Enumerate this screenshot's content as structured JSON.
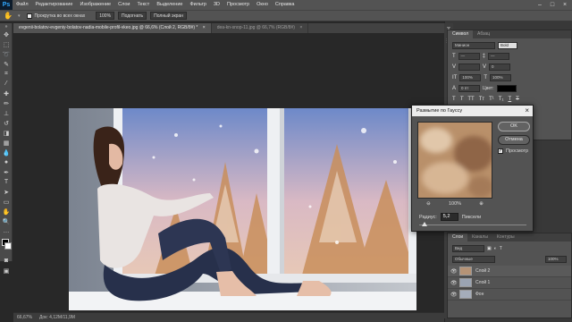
{
  "menu": {
    "app": "Ps",
    "items": [
      "Файл",
      "Редактирование",
      "Изображение",
      "Слои",
      "Текст",
      "Выделение",
      "Фильтр",
      "3D",
      "Просмотр",
      "Окно",
      "Справка"
    ]
  },
  "options": {
    "scroll_all": "Прокрутка во всех окнах",
    "zoom": "100%",
    "fit_button": "Подогнать",
    "full_screen_button": "Полный экран"
  },
  "tabs": [
    {
      "label": "evgenii-bolatov-evgeniy-bolatov-nadia-mobile-profil-vkeo.jpg @ 66,6% (Слой 2, RGB/8#) *",
      "close": "×"
    },
    {
      "label": "dea-kn-snop-11.jpg @ 66,7% (RGB/8#)",
      "close": "×"
    }
  ],
  "status": {
    "zoom": "66,67%",
    "doc": "Док: 4,12M/11,9M"
  },
  "character_panel": {
    "tabs": [
      "Символ",
      "Абзац"
    ],
    "font_family": "Минион",
    "font_style": "Bold",
    "size": "—",
    "leading": "—",
    "tracking": "0",
    "scale": "100%",
    "baseline": "0 пт",
    "color_label": "Цвет:"
  },
  "layers_panel": {
    "tabs": [
      "Слои",
      "Каналы",
      "Контуры"
    ],
    "filter_label": "Вид",
    "blend_mode": "Обычные",
    "opacity": "100%",
    "layers": [
      {
        "name": "Слой 2",
        "visible": true,
        "selected": true
      },
      {
        "name": "Слой 1",
        "visible": true,
        "selected": false
      },
      {
        "name": "Фон",
        "visible": true,
        "selected": false
      }
    ]
  },
  "dialog": {
    "title": "Размытие по Гауссу",
    "ok": "OK",
    "cancel": "Отмена",
    "preview_label": "Просмотр",
    "preview_checked": true,
    "zoom": "100%",
    "radius_label": "Радиус:",
    "radius_value": "5,2",
    "radius_unit": "Пиксели",
    "radius_slider_fraction": 0.05
  },
  "colors": {
    "accent": "#31a8ff",
    "panel": "#535353",
    "workspace": "#282828"
  }
}
